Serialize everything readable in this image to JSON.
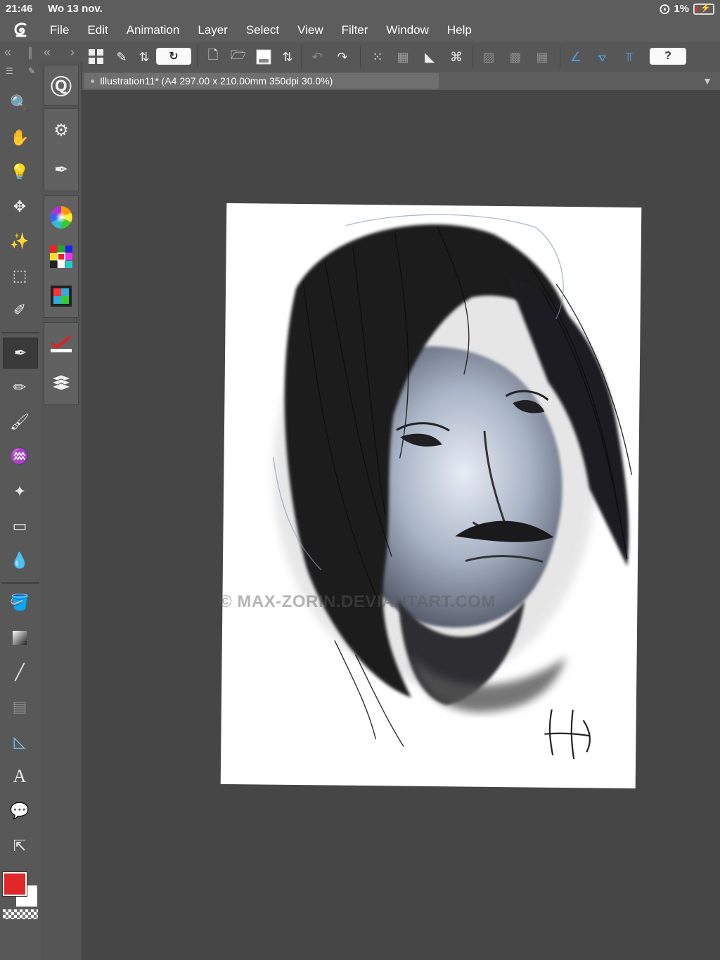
{
  "status": {
    "time": "21:46",
    "date": "Wo 13 nov.",
    "battery": "1%"
  },
  "menu": {
    "items": [
      "File",
      "Edit",
      "Animation",
      "Layer",
      "Select",
      "View",
      "Filter",
      "Window",
      "Help"
    ]
  },
  "toolbar": {
    "icons": [
      "layout-icon",
      "transform-icon",
      "updown-arrows-icon",
      "sync-icon",
      "new-file-icon",
      "open-file-icon",
      "save-icon",
      "updown-arrows-icon",
      "undo-icon",
      "redo-icon",
      "clear-icon",
      "crop-icon",
      "fill-icon",
      "transform-select-icon",
      "hide-selection-icon",
      "snap-ruler-icon",
      "snap-grid-icon",
      "ruler-icon",
      "ruler-snap-icon",
      "special-ruler-icon",
      "help-icon"
    ],
    "help_label": "?"
  },
  "document": {
    "tab_title": "Illustration11* (A4 297.00 x 210.00mm 350dpi 30.0%)"
  },
  "tools": [
    "zoom-icon",
    "hand-icon",
    "lightbulb-icon",
    "move-icon",
    "magic-wand-icon",
    "selection-icon",
    "eyedropper-icon",
    "pen-icon",
    "pencil-icon",
    "brush-icon",
    "airbrush-icon",
    "decoration-icon",
    "eraser-icon",
    "blend-icon",
    "fill-bucket-icon",
    "gradient-icon",
    "line-icon",
    "frame-icon",
    "ruler-icon",
    "text-icon",
    "balloon-icon",
    "correct-line-icon"
  ],
  "sub_tools": [
    "sub-tool-icon",
    "tool-property-icon",
    "brush-size-icon",
    "color-wheel-icon",
    "color-set-icon",
    "timeline-icon",
    "check-icon",
    "layers-icon"
  ],
  "colors": {
    "foreground": "#e02828",
    "background": "#ffffff"
  },
  "watermark": "© MAX-ZORIN.DEVIANTART.COM"
}
